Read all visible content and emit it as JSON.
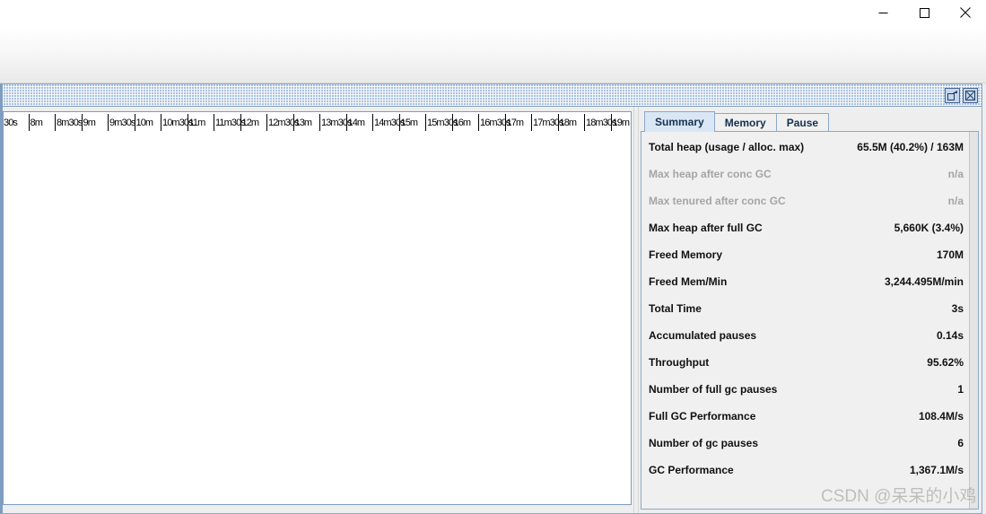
{
  "window": {
    "controls": {
      "minimize_label": "Minimize",
      "maximize_label": "Maximize",
      "close_label": "Close"
    }
  },
  "internal_frame": {
    "title": "",
    "restore_label": "Restore",
    "close_label": "Close"
  },
  "chart": {
    "x_axis_ticks": [
      "30s",
      "8m",
      "8m30s",
      "9m",
      "9m30s",
      "10m",
      "10m30s",
      "11m",
      "11m30s",
      "12m",
      "12m30s",
      "13m",
      "13m30s",
      "14m",
      "14m30s",
      "15m",
      "15m30s",
      "16m",
      "16m30s",
      "17m",
      "17m30s",
      "18m",
      "18m30s",
      "19m"
    ]
  },
  "model_panel": {
    "tabs": [
      {
        "label": "Summary",
        "selected": true
      },
      {
        "label": "Memory",
        "selected": false
      },
      {
        "label": "Pause",
        "selected": false
      }
    ],
    "summary_rows": [
      {
        "name": "Total heap (usage / alloc. max)",
        "value": "65.5M (40.2%) / 163M",
        "disabled": false
      },
      {
        "name": "Max heap after conc GC",
        "value": "n/a",
        "disabled": true
      },
      {
        "name": "Max tenured after conc GC",
        "value": "n/a",
        "disabled": true
      },
      {
        "name": "Max heap after full GC",
        "value": "5,660K (3.4%)",
        "disabled": false
      },
      {
        "name": "Freed Memory",
        "value": "170M",
        "disabled": false
      },
      {
        "name": "Freed Mem/Min",
        "value": "3,244.495M/min",
        "disabled": false
      },
      {
        "name": "Total Time",
        "value": "3s",
        "disabled": false
      },
      {
        "name": "Accumulated pauses",
        "value": "0.14s",
        "disabled": false
      },
      {
        "name": "Throughput",
        "value": "95.62%",
        "disabled": false
      },
      {
        "name": "Number of full gc pauses",
        "value": "1",
        "disabled": false
      },
      {
        "name": "Full GC Performance",
        "value": "108.4M/s",
        "disabled": false
      },
      {
        "name": "Number of gc pauses",
        "value": "6",
        "disabled": false
      },
      {
        "name": "GC Performance",
        "value": "1,367.1M/s",
        "disabled": false
      }
    ]
  },
  "watermark": {
    "text": "CSDN @呆呆的小鸡"
  },
  "colors": {
    "frame_border": "#8fa9c9",
    "titlebar": "#a9c0dd",
    "tab_selected": "#d9e7f5",
    "panel_bg": "#f0f0f0",
    "disabled_text": "#a5a5a5"
  }
}
